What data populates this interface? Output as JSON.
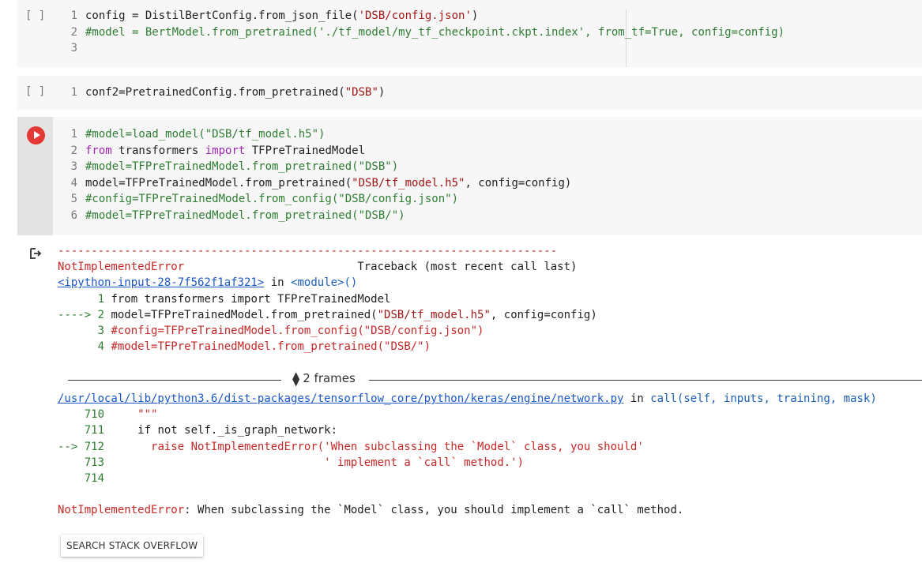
{
  "cells": [
    {
      "bracket": "[ ]",
      "lines": [
        {
          "n": "1",
          "code": "config = DistilBertConfig.from_json_file('DSB/config.json')"
        },
        {
          "n": "2",
          "code": "#model = BertModel.from_pretrained('./tf_model/my_tf_checkpoint.ckpt.index', from_tf=True, config=config)"
        },
        {
          "n": "3",
          "code": ""
        }
      ]
    },
    {
      "bracket": "[ ]",
      "lines": [
        {
          "n": "1",
          "code": "conf2=PretrainedConfig.from_pretrained(\"DSB\")"
        }
      ]
    },
    {
      "lines": [
        {
          "n": "1",
          "code": "#model=load_model(\"DSB/tf_model.h5\")"
        },
        {
          "n": "2",
          "code": "from transformers import TFPreTrainedModel"
        },
        {
          "n": "3",
          "code": "#model=TFPreTrainedModel.from_pretrained(\"DSB\")"
        },
        {
          "n": "4",
          "code": "model=TFPreTrainedModel.from_pretrained(\"DSB/tf_model.h5\", config=config)"
        },
        {
          "n": "5",
          "code": "#config=TFPreTrainedModel.from_config(\"DSB/config.json\")"
        },
        {
          "n": "6",
          "code": "#model=TFPreTrainedModel.from_pretrained(\"DSB/\")"
        }
      ]
    }
  ],
  "output": {
    "dashes": "---------------------------------------------------------------------------",
    "error_name": "NotImplementedError",
    "traceback_header": "Traceback (most recent call last)",
    "input_link": "<ipython-input-28-7f562f1af321>",
    "in_word": "in",
    "module": "<module>()",
    "trace1": [
      {
        "prefix": "      ",
        "n": "1",
        "text": "from transformers import TFPreTrainedModel"
      },
      {
        "prefix": "----> ",
        "n": "2",
        "text": "model=TFPreTrainedModel.from_pretrained(\"DSB/tf_model.h5\", config=config)"
      },
      {
        "prefix": "      ",
        "n": "3",
        "text": "#config=TFPreTrainedModel.from_config(\"DSB/config.json\")"
      },
      {
        "prefix": "      ",
        "n": "4",
        "text": "#model=TFPreTrainedModel.from_pretrained(\"DSB/\")"
      }
    ],
    "frames_label": "2 frames",
    "file_link": "/usr/local/lib/python3.6/dist-packages/tensorflow_core/python/keras/engine/network.py",
    "file_in": "in",
    "func": "call(self, inputs, training, mask)",
    "trace2": [
      {
        "prefix": "    ",
        "n": "710",
        "text": "    \"\"\""
      },
      {
        "prefix": "    ",
        "n": "711",
        "text": "    if not self._is_graph_network:"
      },
      {
        "prefix": "--> ",
        "n": "712",
        "text": "      raise NotImplementedError('When subclassing the `Model` class, you should'"
      },
      {
        "prefix": "    ",
        "n": "713",
        "text": "                                ' implement a `call` method.')"
      },
      {
        "prefix": "    ",
        "n": "714",
        "text": ""
      }
    ],
    "final_error_name": "NotImplementedError",
    "final_message": ": When subclassing the `Model` class, you should implement a `call` method."
  },
  "search_button": "SEARCH STACK OVERFLOW",
  "colors": {
    "run": "#e53935",
    "error": "#c62828",
    "link": "#1a56c6",
    "string": "#a31515",
    "keyword": "#9c27b0"
  }
}
